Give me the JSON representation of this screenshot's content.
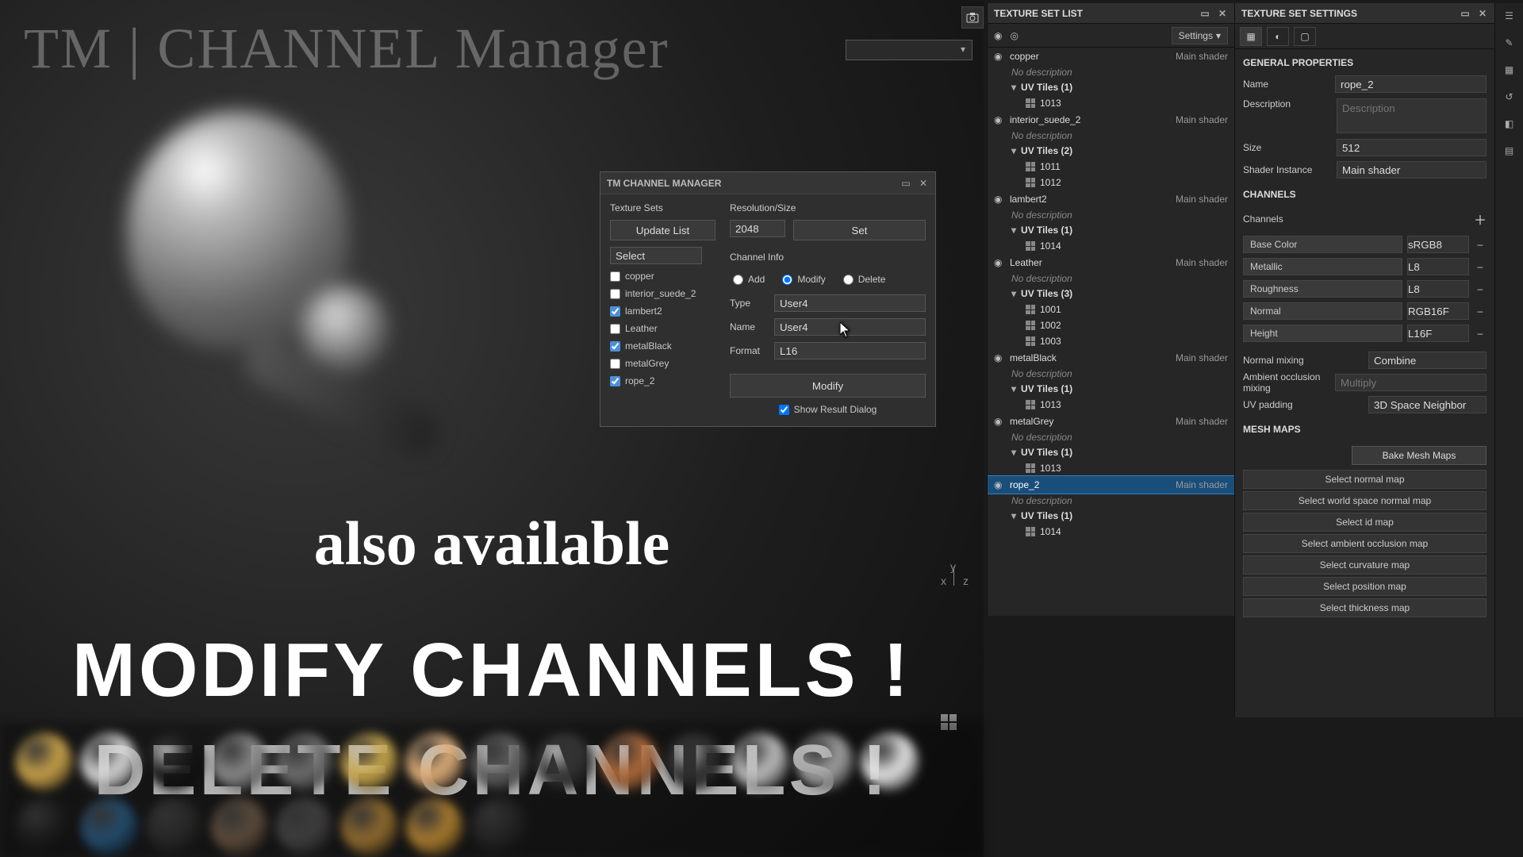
{
  "watermark": "TM | CHANNEL Manager",
  "overlay": {
    "line1": "also available",
    "line2": "MODIFY CHANNELS !",
    "line3": "DELETE CHANNELS !"
  },
  "axis": {
    "x": "x",
    "y": "y",
    "z": "z"
  },
  "dialog": {
    "title": "TM CHANNEL MANAGER",
    "texture_sets_label": "Texture Sets",
    "resolution_label": "Resolution/Size",
    "update_list": "Update List",
    "set": "Set",
    "resolution_value": "2048",
    "select_label": "Select",
    "sets": [
      {
        "name": "copper",
        "checked": false
      },
      {
        "name": "interior_suede_2",
        "checked": false
      },
      {
        "name": "lambert2",
        "checked": true
      },
      {
        "name": "Leather",
        "checked": false
      },
      {
        "name": "metalBlack",
        "checked": true
      },
      {
        "name": "metalGrey",
        "checked": false
      },
      {
        "name": "rope_2",
        "checked": true
      }
    ],
    "channel_info_label": "Channel Info",
    "radio": {
      "add": "Add",
      "modify": "Modify",
      "delete": "Delete",
      "selected": "Modify"
    },
    "type_label": "Type",
    "type_value": "User4",
    "name_label": "Name",
    "name_value": "User4",
    "format_label": "Format",
    "format_value": "L16",
    "action_btn": "Modify",
    "show_result": "Show Result Dialog",
    "show_result_checked": true
  },
  "tsl": {
    "title": "TEXTURE SET LIST",
    "settings": "Settings",
    "no_desc": "No description",
    "uv_tiles_prefix": "UV Tiles",
    "shader": "Main shader",
    "items": [
      {
        "name": "copper",
        "uvcount": 1,
        "tiles": [
          "1013"
        ],
        "selected": false
      },
      {
        "name": "interior_suede_2",
        "uvcount": 2,
        "tiles": [
          "1011",
          "1012"
        ],
        "selected": false
      },
      {
        "name": "lambert2",
        "uvcount": 1,
        "tiles": [
          "1014"
        ],
        "selected": false
      },
      {
        "name": "Leather",
        "uvcount": 3,
        "tiles": [
          "1001",
          "1002",
          "1003"
        ],
        "selected": false
      },
      {
        "name": "metalBlack",
        "uvcount": 1,
        "tiles": [
          "1013"
        ],
        "selected": false
      },
      {
        "name": "metalGrey",
        "uvcount": 1,
        "tiles": [
          "1013"
        ],
        "selected": false
      },
      {
        "name": "rope_2",
        "uvcount": 1,
        "tiles": [
          "1014"
        ],
        "selected": true
      }
    ]
  },
  "tss": {
    "title": "TEXTURE SET SETTINGS",
    "general": "GENERAL PROPERTIES",
    "name_label": "Name",
    "name_value": "rope_2",
    "desc_label": "Description",
    "desc_placeholder": "Description",
    "size_label": "Size",
    "size_value": "512",
    "shader_label": "Shader Instance",
    "shader_value": "Main shader",
    "channels_header": "CHANNELS",
    "channels_label": "Channels",
    "channels": [
      {
        "name": "Base Color",
        "fmt": "sRGB8"
      },
      {
        "name": "Metallic",
        "fmt": "L8"
      },
      {
        "name": "Roughness",
        "fmt": "L8"
      },
      {
        "name": "Normal",
        "fmt": "RGB16F"
      },
      {
        "name": "Height",
        "fmt": "L16F"
      }
    ],
    "normal_mixing_label": "Normal mixing",
    "normal_mixing_value": "Combine",
    "ao_mixing_label": "Ambient occlusion mixing",
    "ao_mixing_value": "Multiply",
    "uv_padding_label": "UV padding",
    "uv_padding_value": "3D Space Neighbor",
    "mesh_maps_header": "MESH MAPS",
    "bake": "Bake Mesh Maps",
    "maps": [
      "Select normal map",
      "Select world space normal map",
      "Select id map",
      "Select ambient occlusion map",
      "Select curvature map",
      "Select position map",
      "Select thickness map"
    ]
  },
  "swatch_colors": [
    "#c9a24a",
    "#d8d8d8",
    "#161616",
    "#8a8a8a",
    "#6e6e6e",
    "#caa94d",
    "#e1b07a",
    "#606060",
    "#333333",
    "#b06a3a",
    "#2f2f2f",
    "#bfbfbf",
    "#a3a3a3",
    "#e6e6e6",
    "#1a1a1a",
    "#234b6b",
    "#262626",
    "#5a4a3a",
    "#3d3d3d",
    "#8f6a2e",
    "#a87b2f",
    "#222222"
  ]
}
